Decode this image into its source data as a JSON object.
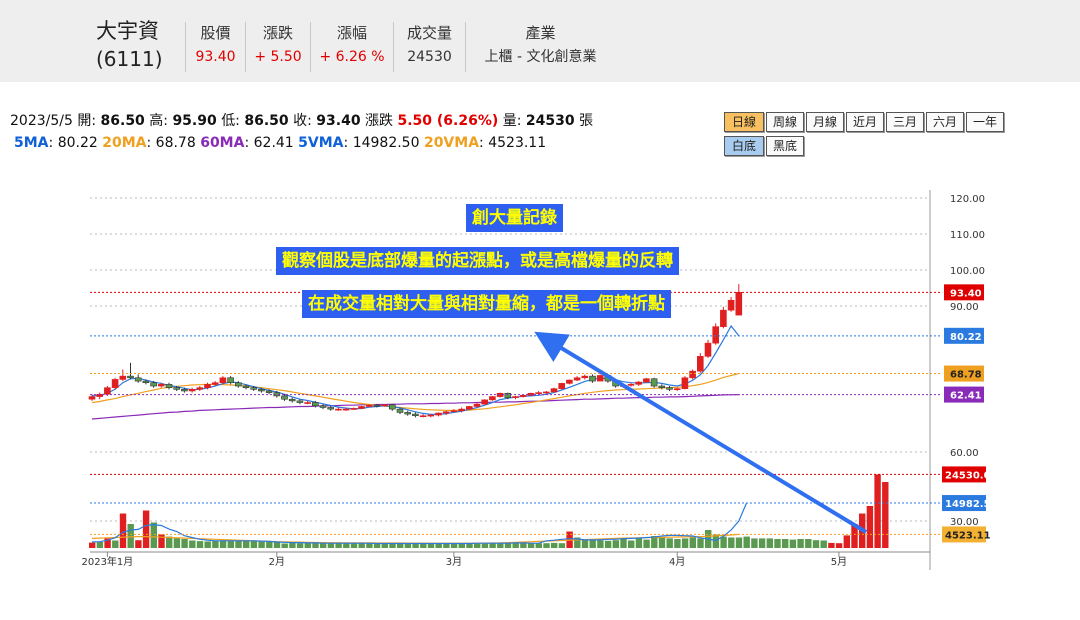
{
  "header": {
    "name": "大宇資",
    "code": "(6111)",
    "columns": [
      {
        "label": "股價",
        "value": "93.40",
        "red": true
      },
      {
        "label": "漲跌",
        "value": "+ 5.50",
        "red": true
      },
      {
        "label": "漲幅",
        "value": "+ 6.26 %",
        "red": true
      },
      {
        "label": "成交量",
        "value": "24530",
        "red": false
      },
      {
        "label": "產業",
        "value": "上櫃 - 文化創意業",
        "red": false
      }
    ]
  },
  "info": {
    "date": "2023/5/5",
    "open_label": "開:",
    "open": "86.50",
    "high_label": "高:",
    "high": "95.90",
    "low_label": "低:",
    "low": "86.50",
    "close_label": "收:",
    "close": "93.40",
    "change_label": "漲跌",
    "change": "5.50 (6.26%)",
    "volume_label": "量:",
    "volume": "24530",
    "volume_unit": "張",
    "ma5_label": "5MA",
    "ma5": "80.22",
    "ma20_label": "20MA",
    "ma20": "68.78",
    "ma60_label": "60MA",
    "ma60": "62.41",
    "vma5_label": "5VMA",
    "vma5": "14982.50",
    "vma20_label": "20VMA",
    "vma20": "4523.11"
  },
  "buttons": {
    "row1": [
      "日線",
      "周線",
      "月線",
      "近月",
      "三月",
      "六月",
      "一年"
    ],
    "row2": [
      "白底",
      "黑底"
    ]
  },
  "annotations": {
    "line1": "創大量記錄",
    "line2": "觀察個股是底部爆量的起漲點，或是高檔爆量的反轉",
    "line3": "在成交量相對大量與相對量縮，都是一個轉折點"
  },
  "colors": {
    "up": "#e02020",
    "down": "#5a9a50",
    "ma5": "#2a7ae0",
    "ma20": "#f0a020",
    "ma60": "#8a2ab8",
    "annotation_bg": "#2f5ff0",
    "annotation_text": "#ffff00"
  },
  "chart_data": {
    "type": "candlestick",
    "price_axis_ticks": [
      "120.00",
      "110.00",
      "100.00",
      "90.00",
      "60.00",
      "50.00"
    ],
    "volume_axis_ticks": [
      "30.00"
    ],
    "price_ylim": [
      45,
      122
    ],
    "x_labels": [
      "2023年1月",
      "2月",
      "3月",
      "4月",
      "5月"
    ],
    "x_label_index": [
      2,
      24,
      47,
      76,
      97
    ],
    "price_markers": [
      {
        "label": "93.40",
        "value": 93.4,
        "color": "#e00000"
      },
      {
        "label": "80.22",
        "value": 80.22,
        "color": "#2a7ae0"
      },
      {
        "label": "68.78",
        "value": 68.78,
        "color": "#f0a020"
      },
      {
        "label": "62.41",
        "value": 62.41,
        "color": "#8a2ab8"
      }
    ],
    "volume_markers": [
      {
        "label": "24530.00",
        "value": 24530,
        "color": "#e00000"
      },
      {
        "label": "14982.50",
        "value": 14982.5,
        "color": "#2a7ae0"
      },
      {
        "label": "4523.11",
        "value": 4523.11,
        "color": "#f0a020"
      }
    ],
    "volume_ylim": [
      0,
      26000
    ],
    "ohlc": [
      [
        61,
        62.5,
        60.5,
        61.8
      ],
      [
        61.8,
        63,
        61,
        62.5
      ],
      [
        62.5,
        65,
        62,
        64.5
      ],
      [
        64.5,
        67.5,
        64,
        67
      ],
      [
        67,
        70,
        66.5,
        68
      ],
      [
        68,
        72,
        67,
        67.5
      ],
      [
        67.5,
        68.5,
        66,
        66.5
      ],
      [
        66.5,
        67,
        65.5,
        66
      ],
      [
        66,
        66.5,
        64.5,
        65
      ],
      [
        65,
        66,
        64.5,
        65.5
      ],
      [
        65.5,
        66,
        64,
        64.5
      ],
      [
        64.5,
        65,
        63.5,
        64
      ],
      [
        64,
        64.5,
        63,
        63.5
      ],
      [
        63.5,
        64.5,
        63,
        64
      ],
      [
        64,
        65,
        63.5,
        64.5
      ],
      [
        64.5,
        66,
        64,
        65.5
      ],
      [
        65.5,
        66.5,
        65,
        66
      ],
      [
        66,
        68,
        65.5,
        67.5
      ],
      [
        67.5,
        68,
        65.5,
        66
      ],
      [
        66,
        66.5,
        64.5,
        65
      ],
      [
        65,
        65.5,
        64,
        64.5
      ],
      [
        64.5,
        65,
        63.5,
        64
      ],
      [
        64,
        64.5,
        63,
        63.5
      ],
      [
        63.5,
        64,
        62.5,
        63
      ],
      [
        63,
        63.5,
        61.5,
        62
      ],
      [
        62,
        62.5,
        60.5,
        61
      ],
      [
        61,
        61.5,
        60,
        60.5
      ],
      [
        60.5,
        61,
        59.5,
        60
      ],
      [
        60,
        60.5,
        59.5,
        60
      ],
      [
        60,
        60.5,
        58.5,
        59
      ],
      [
        59,
        59.5,
        58,
        58.5
      ],
      [
        58.5,
        59,
        57.5,
        58
      ],
      [
        58,
        58.5,
        57.5,
        58
      ],
      [
        58,
        58.5,
        57.5,
        58
      ],
      [
        58,
        58.5,
        57.8,
        58.2
      ],
      [
        58.2,
        59,
        58,
        58.8
      ],
      [
        58.8,
        59.5,
        58.5,
        59.2
      ],
      [
        59.2,
        59.5,
        58.5,
        59
      ],
      [
        59,
        59.5,
        58.8,
        59.3
      ],
      [
        59.3,
        59.5,
        57.5,
        58
      ],
      [
        58,
        58.5,
        56.5,
        57
      ],
      [
        57,
        57.5,
        56,
        56.5
      ],
      [
        56.5,
        57,
        55.5,
        56
      ],
      [
        56,
        56.5,
        55.5,
        56
      ],
      [
        56,
        56.5,
        55.5,
        56.2
      ],
      [
        56.2,
        57,
        55.8,
        56.8
      ],
      [
        56.8,
        57.5,
        56.2,
        57.2
      ],
      [
        57.2,
        58,
        57,
        57.5
      ],
      [
        57.5,
        58.5,
        57,
        58
      ],
      [
        58,
        59,
        57.8,
        58.8
      ],
      [
        58.8,
        60,
        58.5,
        59.5
      ],
      [
        59.5,
        61,
        59.5,
        60.8
      ],
      [
        60.8,
        62,
        60.5,
        61.8
      ],
      [
        61.8,
        63,
        61.5,
        62.8
      ],
      [
        62.8,
        63,
        61,
        61.5
      ],
      [
        61.5,
        62,
        61,
        61.8
      ],
      [
        61.8,
        62.5,
        61.5,
        62.2
      ],
      [
        62.2,
        63,
        62,
        62.8
      ],
      [
        62.8,
        63.5,
        62.5,
        63
      ],
      [
        63,
        63.5,
        62.5,
        63.2
      ],
      [
        63.2,
        64.5,
        63,
        64.2
      ],
      [
        64.2,
        66,
        64,
        65.8
      ],
      [
        65.8,
        67,
        65.5,
        66.8
      ],
      [
        66.8,
        68,
        66.5,
        67.5
      ],
      [
        67.5,
        68.5,
        67,
        68
      ],
      [
        68,
        68.5,
        66,
        66.5
      ],
      [
        66.5,
        68.5,
        66.5,
        68.2
      ],
      [
        68.2,
        68.5,
        66,
        66.5
      ],
      [
        66.5,
        67,
        64.5,
        65
      ],
      [
        65,
        65.5,
        64.5,
        65.2
      ],
      [
        65.2,
        66,
        64.8,
        65.5
      ],
      [
        65.5,
        66.5,
        65,
        66.2
      ],
      [
        66.2,
        67.5,
        66,
        67.2
      ],
      [
        67.2,
        67.5,
        64.5,
        65
      ],
      [
        65,
        65.5,
        64,
        64.5
      ],
      [
        64.5,
        65,
        63.5,
        64
      ],
      [
        64,
        64.5,
        63.5,
        64.2
      ],
      [
        64.2,
        68,
        64,
        67.5
      ],
      [
        67.5,
        70,
        67,
        69.5
      ],
      [
        69.5,
        75,
        69,
        74
      ],
      [
        74,
        79,
        73.5,
        78
      ],
      [
        78,
        84,
        77.5,
        83
      ],
      [
        83,
        89,
        82.5,
        88
      ],
      [
        88,
        92,
        87.5,
        91
      ],
      [
        86.5,
        95.9,
        86.5,
        93.4
      ]
    ],
    "volume": [
      1800,
      2000,
      3200,
      2500,
      11500,
      8000,
      2600,
      12500,
      8500,
      4500,
      3800,
      3300,
      3000,
      2500,
      2300,
      2200,
      2500,
      2600,
      2300,
      2400,
      2400,
      2300,
      2400,
      2300,
      2200,
      1500,
      1700,
      1600,
      2000,
      1800,
      1600,
      1600,
      1700,
      1500,
      1500,
      1600,
      1600,
      1600,
      1500,
      1500,
      1500,
      1500,
      1400,
      1500,
      1500,
      1600,
      1500,
      1400,
      1500,
      1500,
      1600,
      1700,
      1600,
      1600,
      1600,
      1700,
      1700,
      1600,
      1600,
      1600,
      1700,
      1600,
      5500,
      3500,
      2800,
      2600,
      2500,
      2400,
      2600,
      3000,
      2500,
      3200,
      2800,
      4000,
      3500,
      3200,
      3000,
      3200,
      3500,
      3200,
      6000,
      4500,
      3800,
      3500,
      3500,
      3800,
      3200,
      3200,
      3200,
      3000,
      3000,
      2800,
      3000,
      3000,
      2600,
      2500,
      1700,
      1600,
      4200,
      8000,
      11500,
      14000,
      24530,
      22000
    ],
    "volume_down": [
      1,
      3,
      5,
      8,
      10,
      11,
      12,
      13,
      14,
      15,
      16,
      17,
      18,
      19,
      20,
      21,
      22,
      23,
      24,
      25,
      26,
      27,
      28,
      29,
      30,
      31,
      32,
      33,
      34,
      35,
      36,
      37,
      38,
      39,
      40,
      41,
      42,
      43,
      44,
      45,
      46,
      47,
      48,
      49,
      50,
      51,
      52,
      53,
      54,
      55,
      56,
      57,
      58,
      59,
      60,
      61,
      63,
      64,
      65,
      66,
      67,
      68,
      69,
      70,
      71,
      72,
      73,
      74,
      75,
      76,
      77,
      78,
      79,
      80,
      81,
      82,
      83,
      84,
      85,
      86,
      87,
      88,
      89,
      90,
      91,
      92,
      93,
      94,
      95
    ],
    "ma5": [
      62,
      62.2,
      62.8,
      64,
      66,
      67.2,
      67.3,
      66.8,
      66.2,
      65.8,
      65.2,
      64.8,
      64.3,
      63.9,
      64,
      64.4,
      65,
      65.7,
      66.2,
      66,
      65.4,
      64.8,
      64.2,
      63.7,
      63.2,
      62.5,
      61.7,
      61,
      60.6,
      60.1,
      59.6,
      59.1,
      58.6,
      58.3,
      58.1,
      58.2,
      58.6,
      58.8,
      59,
      58.8,
      58.4,
      57.8,
      57.2,
      56.7,
      56.4,
      56.4,
      56.6,
      57,
      57.4,
      57.9,
      58.5,
      59.2,
      60,
      60.9,
      61.3,
      61.6,
      61.9,
      62,
      62.2,
      62.5,
      63,
      63.8,
      64.6,
      65.5,
      66.4,
      67,
      67.4,
      67.3,
      66.9,
      66.3,
      66,
      65.9,
      66,
      66.1,
      65.8,
      65.3,
      65,
      65.6,
      66.7,
      68.4,
      71.2,
      75,
      79,
      83.2,
      80.22
    ],
    "ma20": [
      60,
      60.3,
      60.8,
      61.2,
      61.8,
      62.3,
      62.8,
      63.3,
      63.8,
      64.3,
      64.6,
      64.9,
      65.1,
      65.3,
      65.4,
      65.5,
      65.5,
      65.4,
      65.3,
      65.2,
      65,
      64.8,
      64.5,
      64.2,
      63.9,
      63.6,
      63.2,
      62.8,
      62.4,
      62,
      61.6,
      61.2,
      60.8,
      60.4,
      60,
      59.7,
      59.4,
      59.1,
      58.9,
      58.7,
      58.5,
      58.3,
      58.1,
      57.9,
      57.8,
      57.7,
      57.6,
      57.6,
      57.6,
      57.7,
      57.9,
      58.1,
      58.4,
      58.7,
      59,
      59.3,
      59.7,
      60,
      60.4,
      60.8,
      61.2,
      61.6,
      62,
      62.4,
      62.8,
      63.1,
      63.4,
      63.6,
      63.8,
      63.9,
      64,
      64.1,
      64.2,
      64.3,
      64.4,
      64.5,
      64.6,
      64.8,
      65.1,
      65.5,
      66.1,
      66.8,
      67.6,
      68.2,
      68.78
    ],
    "ma60": [
      55,
      55.2,
      55.4,
      55.6,
      55.8,
      56,
      56.2,
      56.4,
      56.6,
      56.8,
      57,
      57.1,
      57.3,
      57.4,
      57.6,
      57.7,
      57.8,
      57.9,
      58,
      58.1,
      58.2,
      58.3,
      58.4,
      58.5,
      58.5,
      58.6,
      58.7,
      58.8,
      58.8,
      58.9,
      59,
      59,
      59.1,
      59.2,
      59.2,
      59.3,
      59.3,
      59.4,
      59.4,
      59.5,
      59.5,
      59.6,
      59.6,
      59.6,
      59.7,
      59.7,
      59.8,
      59.8,
      59.9,
      59.9,
      60,
      60,
      60.1,
      60.1,
      60.2,
      60.2,
      60.3,
      60.4,
      60.4,
      60.5,
      60.6,
      60.7,
      60.8,
      60.9,
      61,
      61,
      61.1,
      61.2,
      61.3,
      61.3,
      61.4,
      61.5,
      61.5,
      61.6,
      61.6,
      61.7,
      61.7,
      61.8,
      61.9,
      62,
      62.1,
      62.2,
      62.3,
      62.35,
      62.41
    ],
    "vma5": [
      2000,
      2100,
      2600,
      3400,
      5200,
      6000,
      6200,
      7500,
      7800,
      7500,
      6300,
      5500,
      4100,
      3500,
      2900,
      2600,
      2400,
      2400,
      2400,
      2400,
      2400,
      2400,
      2300,
      2200,
      2000,
      1900,
      1800,
      1800,
      1700,
      1700,
      1600,
      1600,
      1600,
      1600,
      1600,
      1600,
      1600,
      1500,
      1500,
      1500,
      1500,
      1500,
      1500,
      1500,
      1500,
      1500,
      1500,
      1500,
      1500,
      1500,
      1600,
      1600,
      1600,
      1600,
      1600,
      1700,
      1700,
      1600,
      1600,
      2400,
      2600,
      2900,
      3100,
      3000,
      2700,
      2700,
      2700,
      2900,
      2900,
      3100,
      3200,
      3300,
      3500,
      3600,
      4000,
      4200,
      4200,
      4100,
      4000,
      3400,
      3000,
      2500,
      3900,
      6000,
      9000,
      14982.5
    ],
    "vma20": [
      3200,
      3300,
      3400,
      3500,
      3600,
      3700,
      3800,
      3800,
      3700,
      3600,
      3500,
      3400,
      3300,
      3200,
      3100,
      3000,
      2900,
      2800,
      2700,
      2600,
      2500,
      2400,
      2300,
      2200,
      2100,
      2050,
      2000,
      1950,
      1900,
      1850,
      1800,
      1780,
      1760,
      1740,
      1720,
      1700,
      1690,
      1680,
      1670,
      1660,
      1650,
      1640,
      1630,
      1620,
      1610,
      1600,
      1600,
      1600,
      1600,
      1610,
      1620,
      1640,
      1660,
      1700,
      1800,
      1900,
      2000,
      2100,
      2200,
      2300,
      2400,
      2500,
      2600,
      2700,
      2800,
      2900,
      3000,
      3100,
      3200,
      3300,
      3350,
      3400,
      3450,
      3500,
      3550,
      3600,
      3650,
      3700,
      3750,
      3800,
      3900,
      4050,
      4200,
      4350,
      4523.11
    ]
  }
}
